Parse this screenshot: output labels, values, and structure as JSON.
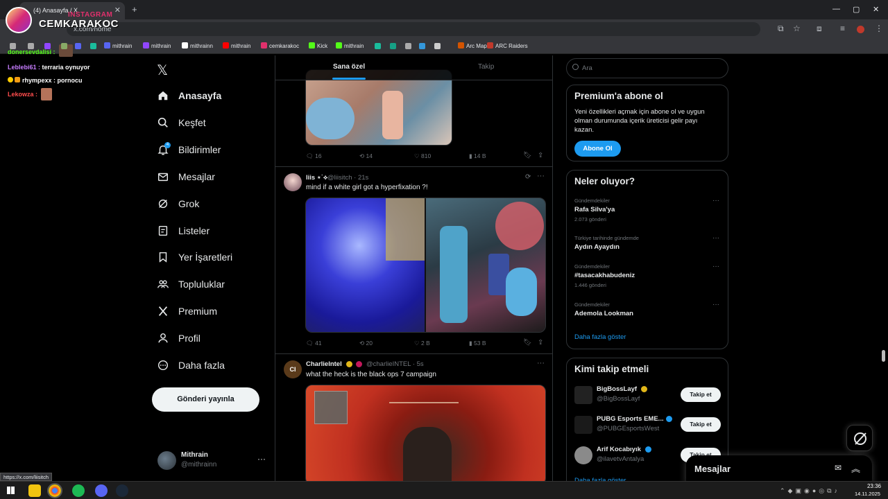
{
  "browser": {
    "tab_title": "(4) Anasayfa / X",
    "url": "x.com/home",
    "status_url": "https://x.com/liisitch",
    "bookmarks": [
      {
        "label": "mithrain",
        "color": "#5865f2"
      },
      {
        "label": "mithrain",
        "color": "#9146ff"
      },
      {
        "label": "mithrainn",
        "color": "#ffffff"
      },
      {
        "label": "mithrain",
        "color": "#ff0000"
      },
      {
        "label": "cemkarakoc",
        "color": "#e1306c"
      },
      {
        "label": "Kick",
        "color": "#53fc18"
      },
      {
        "label": "mithrain",
        "color": "#53fc18"
      },
      {
        "label": "Arc Map",
        "color": "#d35400"
      },
      {
        "label": "ARC Raiders",
        "color": "#c0392b"
      }
    ]
  },
  "overlay": {
    "instagram_label": "INSTAGRAM",
    "streamer_name": "CEMKARAKOC",
    "chat": [
      {
        "user": "donersevdalisi :",
        "msg": "",
        "color": "#53fc18"
      },
      {
        "user": "Leblebi61 :",
        "msg": "terraria oynuyor",
        "color": "#c77dff"
      },
      {
        "user": "rhympexx :",
        "msg": "pornocu",
        "color": "#ffcc00"
      },
      {
        "user": "Lekowza :",
        "msg": "",
        "color": "#ff4d4d"
      }
    ]
  },
  "sidebar": {
    "items": [
      {
        "label": "Anasayfa",
        "icon": "home-icon"
      },
      {
        "label": "Keşfet",
        "icon": "search-icon"
      },
      {
        "label": "Bildirimler",
        "icon": "bell-icon",
        "badge": "4"
      },
      {
        "label": "Mesajlar",
        "icon": "mail-icon"
      },
      {
        "label": "Grok",
        "icon": "grok-icon"
      },
      {
        "label": "Listeler",
        "icon": "list-icon"
      },
      {
        "label": "Yer İşaretleri",
        "icon": "bookmark-icon"
      },
      {
        "label": "Topluluklar",
        "icon": "communities-icon"
      },
      {
        "label": "Premium",
        "icon": "x-icon"
      },
      {
        "label": "Profil",
        "icon": "person-icon"
      },
      {
        "label": "Daha fazla",
        "icon": "more-circle-icon"
      }
    ],
    "post_button": "Gönderi yayınla",
    "account": {
      "name": "Mithrain",
      "handle": "@mithrainn"
    }
  },
  "feed": {
    "tabs": [
      "Sana özel",
      "Takip"
    ],
    "post0_stats": {
      "replies": "16",
      "reposts": "14",
      "likes": "810",
      "views": "14 B"
    },
    "posts": [
      {
        "name": "liis ⋆˙⟡",
        "handle": "@liisitch",
        "time": "· 21s",
        "text": "mind if a white girl got a hyperfixation ?!",
        "stats": {
          "replies": "41",
          "reposts": "20",
          "likes": "2 B",
          "views": "53 B"
        }
      },
      {
        "name": "CharlieIntel",
        "handle": "@charlieINTEL",
        "time": "· 5s",
        "text": "what the heck is the black ops 7 campaign"
      }
    ]
  },
  "right": {
    "search_placeholder": "Ara",
    "premium": {
      "title": "Premium'a abone ol",
      "body": [
        "Yeni özellikleri açmak için abone ol ve uygun",
        "olman durumunda içerik üreticisi gelir payı",
        "kazan."
      ],
      "button": "Abone Ol"
    },
    "trends": {
      "title": "Neler oluyor?",
      "items": [
        {
          "category": "Gündemdekiler",
          "name": "Rafa Silva'ya",
          "count": "2.073 gönderi"
        },
        {
          "category": "Türkiye tarihinde gündemde",
          "name": "Aydın Ayaydın",
          "count": ""
        },
        {
          "category": "Gündemdekiler",
          "name": "#tasacakhabudeniz",
          "count": "1.446 gönderi"
        },
        {
          "category": "Gündemdekiler",
          "name": "Ademola Lookman",
          "count": ""
        }
      ],
      "show_more": "Daha fazla göster"
    },
    "who_to_follow": {
      "title": "Kimi takip etmeli",
      "items": [
        {
          "name": "BigBossLayf",
          "handle": "@BigBossLayf",
          "verified": "gold"
        },
        {
          "name": "PUBG Esports EME...",
          "handle": "@PUBGEsportsWest",
          "verified": "blue"
        },
        {
          "name": "Arif Kocabıyık",
          "handle": "@ilavetvAntalya",
          "verified": "blue"
        }
      ],
      "follow_label": "Takip et",
      "show_more": "Daha fazla göster"
    },
    "messages_drawer": "Mesajlar"
  },
  "taskbar": {
    "time": "23:36",
    "date": "14.11.2025"
  },
  "colors": {
    "accent": "#1d9bf0",
    "border": "#2f3336",
    "muted": "#71767b",
    "gold": "#e2b719"
  }
}
